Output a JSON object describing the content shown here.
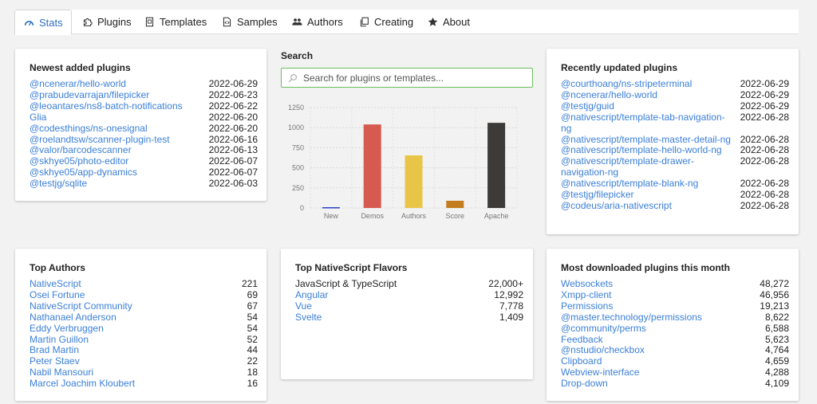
{
  "tabs": [
    {
      "label": "Stats",
      "icon": "gauge-icon",
      "active": true
    },
    {
      "label": "Plugins",
      "icon": "puzzle-icon"
    },
    {
      "label": "Templates",
      "icon": "template-icon"
    },
    {
      "label": "Samples",
      "icon": "code-file-icon"
    },
    {
      "label": "Authors",
      "icon": "users-icon"
    },
    {
      "label": "Creating",
      "icon": "copy-icon"
    },
    {
      "label": "About",
      "icon": "star-icon"
    }
  ],
  "newest": {
    "title": "Newest added plugins",
    "items": [
      {
        "name": "@ncenerar/hello-world",
        "date": "2022-06-29"
      },
      {
        "name": "@prabudevarrajan/filepicker",
        "date": "2022-06-23"
      },
      {
        "name": "@leoantares/ns8-batch-notifications",
        "date": "2022-06-22"
      },
      {
        "name": "Glia",
        "date": "2022-06-20"
      },
      {
        "name": "@codesthings/ns-onesignal",
        "date": "2022-06-20"
      },
      {
        "name": "@roelandtsw/scanner-plugin-test",
        "date": "2022-06-16"
      },
      {
        "name": "@valor/barcodescanner",
        "date": "2022-06-13"
      },
      {
        "name": "@skhye05/photo-editor",
        "date": "2022-06-07"
      },
      {
        "name": "@skhye05/app-dynamics",
        "date": "2022-06-07"
      },
      {
        "name": "@testjg/sqlite",
        "date": "2022-06-03"
      }
    ]
  },
  "search": {
    "title": "Search",
    "placeholder": "Search for plugins or templates..."
  },
  "chart_data": {
    "type": "bar",
    "categories": [
      "New",
      "Demos",
      "Authors",
      "Score",
      "Apache"
    ],
    "values": [
      10,
      1040,
      655,
      90,
      1060
    ],
    "colors": [
      "#2c3ec9",
      "#d65a4f",
      "#e8c547",
      "#c47d1e",
      "#3d3a3a"
    ],
    "yticks": [
      0,
      250,
      500,
      750,
      1000,
      1250
    ],
    "ylim": [
      0,
      1250
    ],
    "grid": true
  },
  "updated": {
    "title": "Recently updated plugins",
    "items": [
      {
        "name": "@courthoang/ns-stripeterminal",
        "date": "2022-06-29"
      },
      {
        "name": "@ncenerar/hello-world",
        "date": "2022-06-29"
      },
      {
        "name": "@testjg/guid",
        "date": "2022-06-29"
      },
      {
        "name": "@nativescript/template-tab-navigation-ng",
        "date": "2022-06-28"
      },
      {
        "name": "@nativescript/template-master-detail-ng",
        "date": "2022-06-28"
      },
      {
        "name": "@nativescript/template-hello-world-ng",
        "date": "2022-06-28"
      },
      {
        "name": "@nativescript/template-drawer-navigation-ng",
        "date": "2022-06-28"
      },
      {
        "name": "@nativescript/template-blank-ng",
        "date": "2022-06-28"
      },
      {
        "name": "@testjg/filepicker",
        "date": "2022-06-28"
      },
      {
        "name": "@codeus/aria-nativescript",
        "date": "2022-06-28"
      }
    ]
  },
  "authors": {
    "title": "Top Authors",
    "items": [
      {
        "name": "NativeScript",
        "count": "221"
      },
      {
        "name": "Osei Fortune",
        "count": "69"
      },
      {
        "name": "NativeScript Community",
        "count": "67"
      },
      {
        "name": "Nathanael Anderson",
        "count": "54"
      },
      {
        "name": "Eddy Verbruggen",
        "count": "54"
      },
      {
        "name": "Martin Guillon",
        "count": "52"
      },
      {
        "name": "Brad Martin",
        "count": "44"
      },
      {
        "name": "Peter Staev",
        "count": "22"
      },
      {
        "name": "Nabil Mansouri",
        "count": "18"
      },
      {
        "name": "Marcel Joachim Kloubert",
        "count": "16"
      }
    ]
  },
  "flavors": {
    "title": "Top NativeScript Flavors",
    "items": [
      {
        "name": "JavaScript & TypeScript",
        "count": "22,000+",
        "link": false
      },
      {
        "name": "Angular",
        "count": "12,992",
        "link": true
      },
      {
        "name": "Vue",
        "count": "7,778",
        "link": true
      },
      {
        "name": "Svelte",
        "count": "1,409",
        "link": true
      }
    ]
  },
  "downloads": {
    "title": "Most downloaded plugins this month",
    "items": [
      {
        "name": "Websockets",
        "count": "48,272"
      },
      {
        "name": "Xmpp-client",
        "count": "46,956"
      },
      {
        "name": "Permissions",
        "count": "19,213"
      },
      {
        "name": "@master.technology/permissions",
        "count": "8,622"
      },
      {
        "name": "@community/perms",
        "count": "6,588"
      },
      {
        "name": "Feedback",
        "count": "5,623"
      },
      {
        "name": "@nstudio/checkbox",
        "count": "4,764"
      },
      {
        "name": "Clipboard",
        "count": "4,659"
      },
      {
        "name": "Webview-interface",
        "count": "4,288"
      },
      {
        "name": "Drop-down",
        "count": "4,109"
      }
    ]
  }
}
